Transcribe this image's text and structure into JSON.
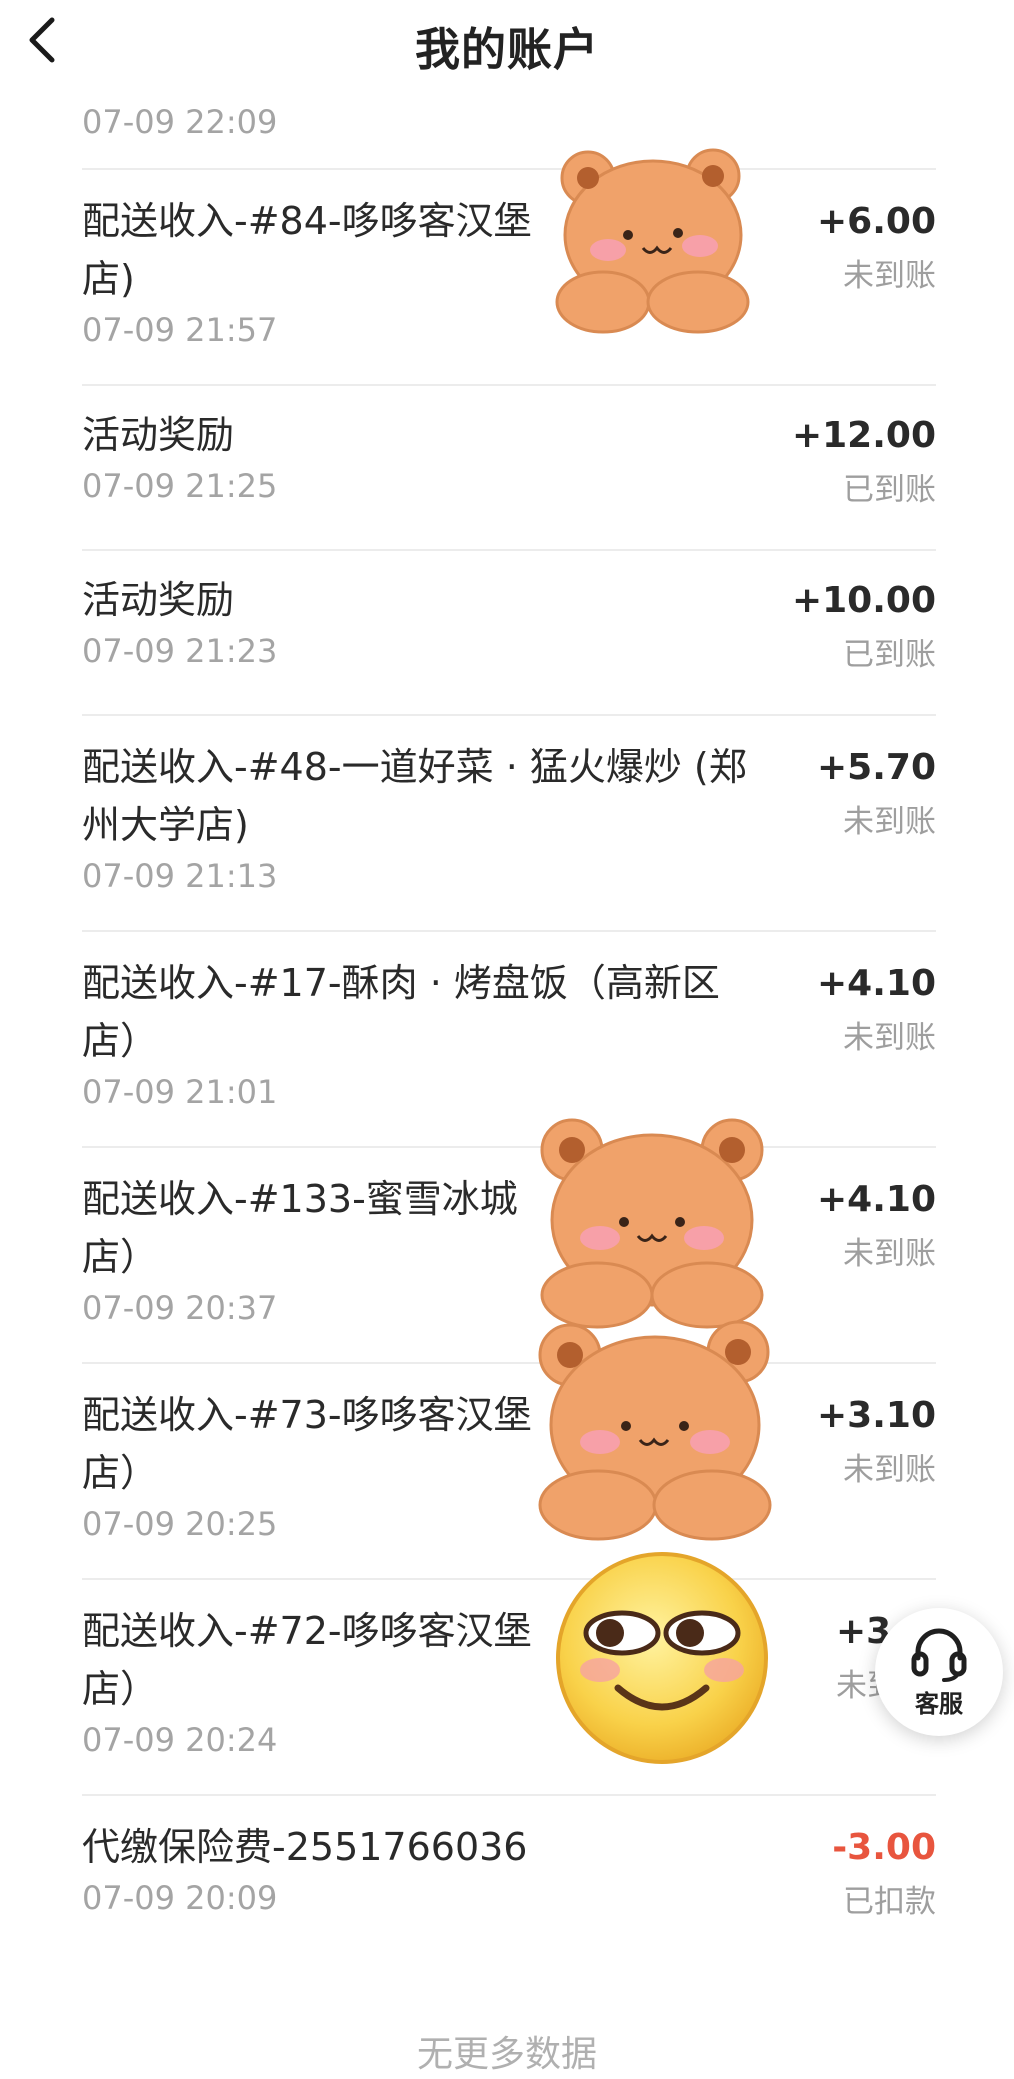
{
  "header": {
    "title": "我的账户"
  },
  "partial_time": "07-09 22:09",
  "records": [
    {
      "desc": "配送收入-#84-哆哆客汉堡店)",
      "time": "07-09 21:57",
      "amount": "+6.00",
      "status": "未到账"
    },
    {
      "desc": "活动奖励",
      "time": "07-09 21:25",
      "amount": "+12.00",
      "status": "已到账"
    },
    {
      "desc": "活动奖励",
      "time": "07-09 21:23",
      "amount": "+10.00",
      "status": "已到账"
    },
    {
      "desc": "配送收入-#48-一道好菜 · 猛火爆炒 (郑州大学店)",
      "time": "07-09 21:13",
      "amount": "+5.70",
      "status": "未到账"
    },
    {
      "desc": "配送收入-#17-酥肉 · 烤盘饭（高新区店）",
      "time": "07-09 21:01",
      "amount": "+4.10",
      "status": "未到账"
    },
    {
      "desc": "配送收入-#133-蜜雪冰城店）",
      "time": "07-09 20:37",
      "amount": "+4.10",
      "status": "未到账"
    },
    {
      "desc": "配送收入-#73-哆哆客汉堡店）",
      "time": "07-09 20:25",
      "amount": "+3.10",
      "status": "未到账"
    },
    {
      "desc": "配送收入-#72-哆哆客汉堡店）",
      "time": "07-09 20:24",
      "amount": "+3",
      "status": "未到"
    },
    {
      "desc": "代缴保险费-2551766036",
      "time": "07-09 20:09",
      "amount": "-3.00",
      "status": "已扣款"
    }
  ],
  "footer": "无更多数据",
  "service_button": {
    "label": "客服",
    "icon": "headset-icon"
  },
  "stickers": [
    "bear-sticker",
    "bear-sticker",
    "bear-sticker",
    "smiling-emoji-sticker"
  ],
  "colors": {
    "negative_amount": "#e8553e",
    "muted_text": "#a4a4a4",
    "divider": "#ececec"
  }
}
